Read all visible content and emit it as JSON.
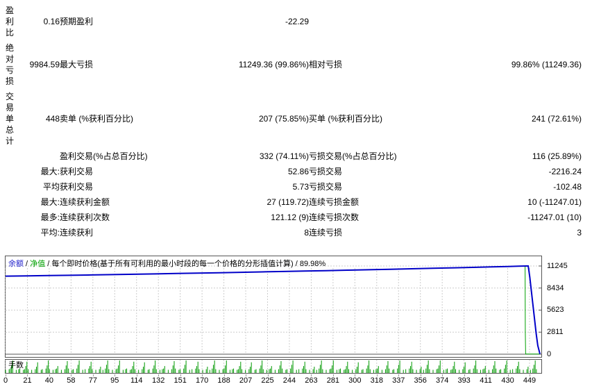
{
  "report": {
    "rows": [
      {
        "c1": "盈利比",
        "c2": "0.16",
        "c3": "预期盈利",
        "c4": "-22.29",
        "c5": "",
        "c6": ""
      },
      {
        "c1": "绝对亏损",
        "c2": "9984.59",
        "c3": "最大亏损",
        "c4": "11249.36 (99.86%)",
        "c5": "相对亏损",
        "c6": "99.86% (11249.36)"
      },
      {
        "c1": "交易单总计",
        "c2": "448",
        "c3": "卖单 (%获利百分比)",
        "c4": "207 (75.85%)",
        "c5": "买单 (%获利百分比)",
        "c6": "241 (72.61%)"
      },
      {
        "c1": "",
        "c2": "",
        "c3": "盈利交易(%占总百分比)",
        "c4": "332 (74.11%)",
        "c5": "亏损交易(%占总百分比)",
        "c6": "116 (25.89%)"
      },
      {
        "c1": "",
        "c2": "最大:",
        "c3": "获利交易",
        "c4": "52.86",
        "c5": "亏损交易",
        "c6": "-2216.24"
      },
      {
        "c1": "",
        "c2": "平均",
        "c3": "获利交易",
        "c4": "5.73",
        "c5": "亏损交易",
        "c6": "-102.48"
      },
      {
        "c1": "",
        "c2": "最大:",
        "c3": "连续获利金额",
        "c4": "27 (119.72)",
        "c5": "连续亏损金额",
        "c6": "10 (-11247.01)"
      },
      {
        "c1": "",
        "c2": "最多:",
        "c3": "连续获利次数",
        "c4": "121.12 (9)",
        "c5": "连续亏损次数",
        "c6": "-11247.01 (10)"
      },
      {
        "c1": "",
        "c2": "平均:",
        "c3": "连续获利",
        "c4": "8",
        "c5": "连续亏损",
        "c6": "3"
      }
    ]
  },
  "chart_data": [
    {
      "type": "line",
      "legend": {
        "balance_label": "余额",
        "equity_label": "净值",
        "sep": " / ",
        "model_label": "每个即时价格(基于所有可利用的最小时段的每一个价格的分形插值计算)",
        "quality": "89.98%"
      },
      "ylim": [
        0,
        11245
      ],
      "y_ticks": [
        0,
        2811,
        5623,
        8434,
        11245
      ],
      "x_ticks": [
        0,
        21,
        40,
        58,
        77,
        95,
        114,
        132,
        151,
        170,
        188,
        207,
        225,
        244,
        263,
        281,
        300,
        318,
        337,
        356,
        374,
        393,
        411,
        430,
        449
      ],
      "series": [
        {
          "name": "净值",
          "color": "#00A000",
          "width": 1,
          "points": [
            [
              0.0,
              9945
            ],
            [
              0.08,
              10015
            ],
            [
              0.16,
              10095
            ],
            [
              0.24,
              10185
            ],
            [
              0.32,
              10285
            ],
            [
              0.4,
              10385
            ],
            [
              0.48,
              10490
            ],
            [
              0.56,
              10595
            ],
            [
              0.64,
              10705
            ],
            [
              0.72,
              10825
            ],
            [
              0.8,
              10945
            ],
            [
              0.88,
              11075
            ],
            [
              0.94,
              11175
            ],
            [
              0.962,
              11225
            ],
            [
              0.9722,
              11240
            ],
            [
              0.9726,
              2800
            ],
            [
              0.9732,
              25
            ],
            [
              1.0,
              15
            ]
          ]
        },
        {
          "name": "余额",
          "color": "#0000C8",
          "width": 2,
          "points": [
            [
              0.0,
              9950
            ],
            [
              0.04,
              9985
            ],
            [
              0.08,
              10020
            ],
            [
              0.12,
              10060
            ],
            [
              0.16,
              10100
            ],
            [
              0.2,
              10145
            ],
            [
              0.24,
              10190
            ],
            [
              0.28,
              10240
            ],
            [
              0.32,
              10290
            ],
            [
              0.36,
              10340
            ],
            [
              0.4,
              10390
            ],
            [
              0.44,
              10440
            ],
            [
              0.48,
              10495
            ],
            [
              0.52,
              10545
            ],
            [
              0.56,
              10600
            ],
            [
              0.6,
              10655
            ],
            [
              0.64,
              10710
            ],
            [
              0.68,
              10770
            ],
            [
              0.72,
              10830
            ],
            [
              0.76,
              10890
            ],
            [
              0.8,
              10950
            ],
            [
              0.84,
              11015
            ],
            [
              0.88,
              11080
            ],
            [
              0.91,
              11130
            ],
            [
              0.94,
              11180
            ],
            [
              0.96,
              11220
            ],
            [
              0.974,
              11249
            ],
            [
              0.978,
              11249
            ],
            [
              0.981,
              9800
            ],
            [
              0.984,
              8000
            ],
            [
              0.987,
              6200
            ],
            [
              0.99,
              4400
            ],
            [
              0.993,
              2600
            ],
            [
              0.996,
              1100
            ],
            [
              1.0,
              30
            ]
          ]
        }
      ]
    },
    {
      "type": "bar",
      "label": "手数",
      "color": "#009900",
      "bar_count": 450,
      "ymax": 1,
      "pattern": [
        0.25,
        0,
        0,
        0.3,
        0.35,
        0.6,
        1.0,
        0,
        0,
        0.25,
        0,
        0.3,
        0.35,
        0,
        0,
        0.25,
        0.3,
        0.55,
        0.9,
        0.3,
        0,
        0,
        0.25,
        0,
        0,
        0.3,
        0.5,
        0.85,
        0,
        0,
        0.25,
        0.3,
        0,
        0,
        0.35,
        0.6,
        1.0,
        0.3,
        0,
        0,
        0.25,
        0,
        0.3,
        0.35,
        0.55,
        0,
        0,
        0.25,
        0,
        0,
        0.3,
        0.6,
        0.95,
        0.35,
        0,
        0,
        0.25,
        0.3,
        0,
        0,
        0.35,
        0.65,
        1.0,
        0,
        0,
        0.25,
        0,
        0.3,
        0,
        0,
        0.35,
        0.55,
        0.9,
        0.3,
        0,
        0,
        0.25,
        0,
        0,
        0.3,
        0.5,
        0,
        0.25,
        0,
        0.35,
        0.65,
        1.0,
        0.3,
        0,
        0
      ]
    }
  ],
  "colors": {
    "grid": "#CCCCCC",
    "axis": "#555555",
    "balance": "#0000C8",
    "equity": "#00A000",
    "lots": "#009900"
  }
}
